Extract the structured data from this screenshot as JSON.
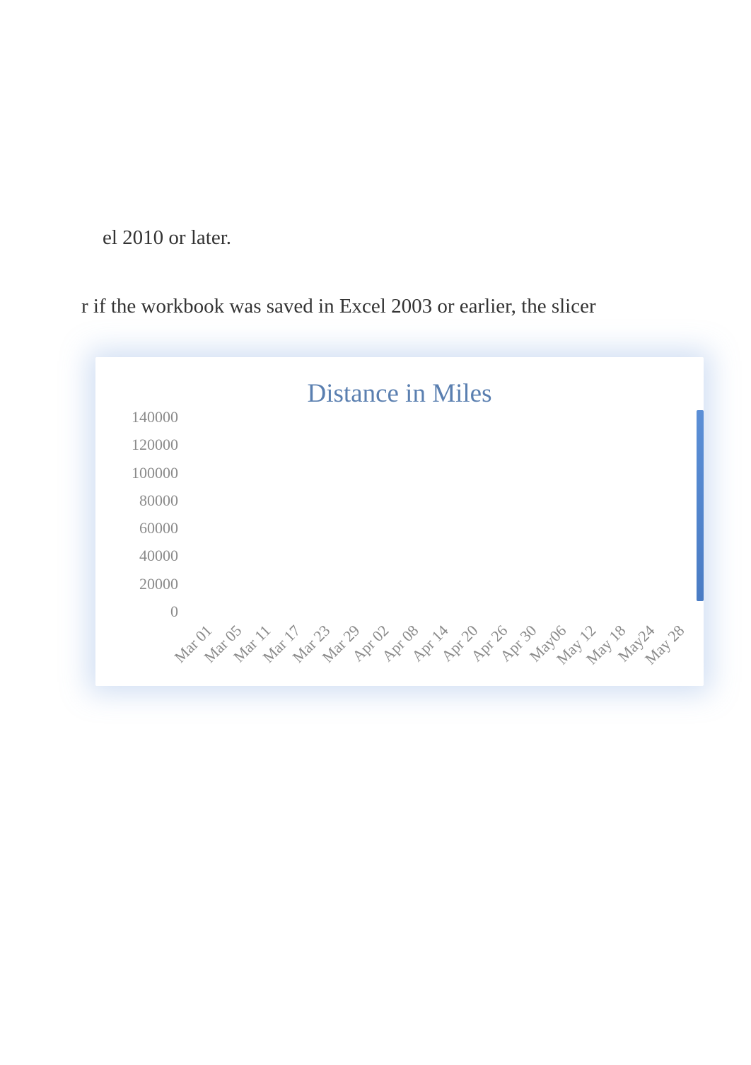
{
  "text_fragments": {
    "line1": " el 2010 or later.",
    "line2": "r if the workbook was saved in Excel 2003 or earlier, the slicer"
  },
  "chart_data": {
    "type": "bar",
    "title": "Distance in Miles",
    "ylabel": "",
    "xlabel": "",
    "ylim": [
      0,
      140000
    ],
    "y_ticks": [
      0,
      20000,
      40000,
      60000,
      80000,
      100000,
      120000,
      140000
    ],
    "categories": [
      "Mar 01",
      "Mar 05",
      "Mar 11",
      "Mar 17",
      "Mar 23",
      "Mar 29",
      "Apr 02",
      "Apr 08",
      "Apr 14",
      "Apr 20",
      "Apr 26",
      "Apr 30",
      "May06",
      "May 12",
      "May 18",
      "May24",
      "May 28"
    ],
    "values": [],
    "grid": false,
    "legend": false
  }
}
